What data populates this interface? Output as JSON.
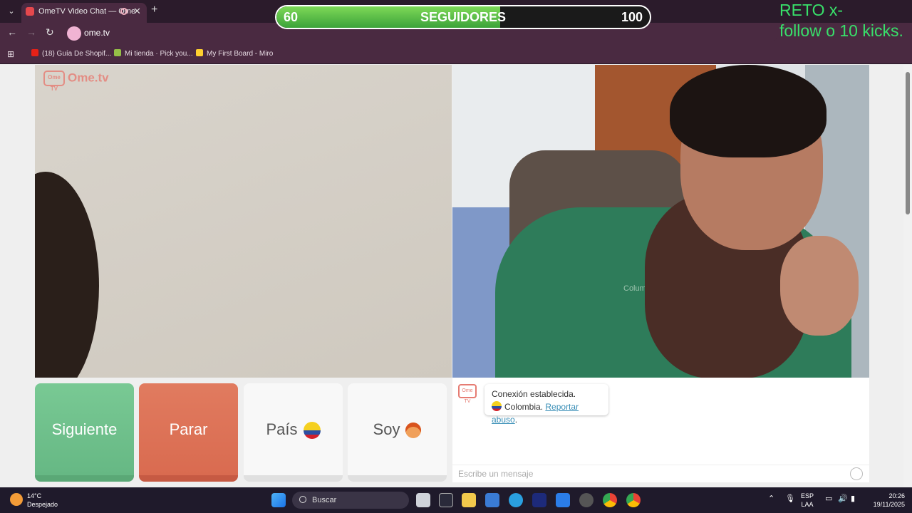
{
  "browser": {
    "tab_title": "OmeTV Video Chat — Ome",
    "tab_close": "✕",
    "new_tab": "+",
    "url": "ome.tv",
    "back": "←",
    "forward": "→",
    "reload": "↻",
    "bookmarks": [
      {
        "label": "(18) Guía De Shopif...",
        "color": "#e62117"
      },
      {
        "label": "Mi tienda · Pick you...",
        "color": "#95bf47"
      },
      {
        "label": "My First Board - Miro",
        "color": "#ffd02f"
      }
    ]
  },
  "overlay": {
    "progress": {
      "start": "60",
      "label": "SEGUIDORES",
      "end": "100",
      "fill_fraction": 0.6
    },
    "reto_line1": "RETO  x-",
    "reto_line2": "follow o 10 kicks."
  },
  "page": {
    "logo_text": "Ome.tv",
    "logo_badge": "Ome TV",
    "buttons": {
      "next": "Siguiente",
      "stop": "Parar",
      "country": "País",
      "gender": "Soy"
    },
    "chat": {
      "logo_badge": "Ome TV",
      "status": "Conexión establecida.",
      "country": "Colombia.",
      "report_link": "Reportar abuso",
      "report_suffix": ".",
      "placeholder": "Escribe un mensaje"
    },
    "jacket_brand": "Columbia"
  },
  "taskbar": {
    "weather_temp": "14°C",
    "weather_desc": "Despejado",
    "search_label": "Buscar",
    "lang_top": "ESP",
    "lang_bottom": "LAA",
    "time": "20:26",
    "date": "19/11/2025"
  }
}
